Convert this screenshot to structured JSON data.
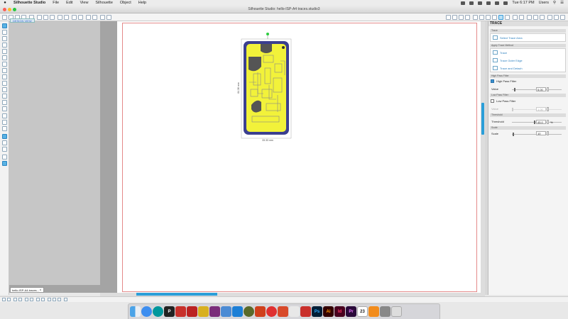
{
  "menubar": {
    "apple": "",
    "items": [
      "Silhouette Studio",
      "File",
      "Edit",
      "View",
      "Silhouette",
      "Object",
      "Help"
    ],
    "time": "Tue 6:17 PM",
    "user": "Users"
  },
  "window": {
    "title": "Silhouette Studio: hello-ISP-A4 traces.studio3",
    "doc_tag": "DESIGN VIEW",
    "doc_tab": "hello-ISP-A4-traces...",
    "doc_tab_close": "x"
  },
  "artwork": {
    "width_label": "33.33 mm",
    "height_label": "64.36 mm"
  },
  "panel": {
    "title": "TRACE",
    "section_trace": "Trace",
    "select_trace_area": "Select Trace Area",
    "section_method": "Apply Trace Method",
    "methods": [
      "Trace",
      "Trace Outer Edge",
      "Trace and Detach"
    ],
    "section_high": "High Pass Filter",
    "high_pass_label": "High Pass Filter",
    "high_value_label": "Value",
    "high_value": "5.00",
    "section_low": "Low Pass Filter",
    "low_pass_label": "Low Pass Filter",
    "low_value_label": "Value",
    "low_value": "1.00",
    "section_threshold": "Threshold",
    "threshold_label": "Threshold",
    "threshold_value": "45.0",
    "threshold_unit": "%",
    "section_scale": "Scale",
    "scale_label": "Scale",
    "scale_value": "10"
  },
  "state": {
    "high_pass_checked": true,
    "low_pass_checked": false,
    "high_value_fraction": 0.05,
    "threshold_fraction": 0.45,
    "scale_fraction": 0.02
  },
  "dock": {
    "apps": [
      "Finder",
      "Safari",
      "Arduino",
      "P",
      "Eagle",
      "Fritzing",
      "Inkscape",
      "Slack",
      "Mail",
      "Cura",
      "CircuitPython",
      "MakerBot",
      "SketchUp",
      "Autodesk",
      "Ps",
      "Ai",
      "Id",
      "Pr",
      "Calendar",
      "VLC",
      "Trash"
    ],
    "labels": {
      "ps": "Ps",
      "ai": "Ai",
      "id": "Id",
      "pr": "Pr",
      "p": "P",
      "cal": "23"
    }
  },
  "colors": {
    "accent": "#2a9ed8",
    "trace_fill": "#f2f23a",
    "border_blue": "#3b3f8f",
    "cut_line": "#e48a8a"
  }
}
